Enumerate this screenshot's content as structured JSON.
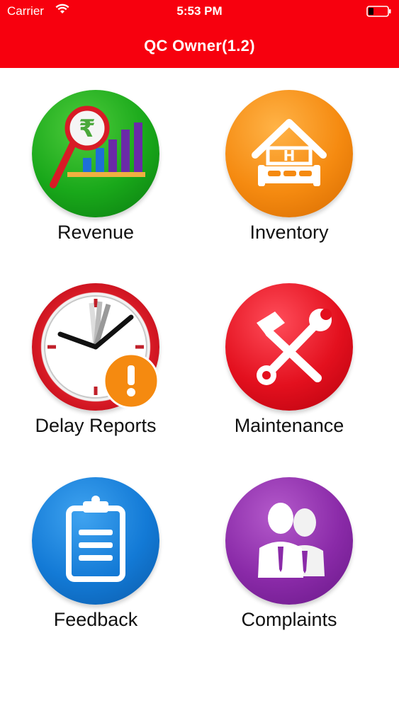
{
  "status_bar": {
    "carrier": "Carrier",
    "time": "5:53 PM"
  },
  "header": {
    "title": "QC Owner(1.2)"
  },
  "menu": {
    "items": [
      {
        "label": "Revenue",
        "icon": "revenue-chart-icon",
        "color": "#19a81a"
      },
      {
        "label": "Inventory",
        "icon": "hotel-house-icon",
        "color": "#f58a10"
      },
      {
        "label": "Delay Reports",
        "icon": "clock-alert-icon",
        "color": "#d81b26"
      },
      {
        "label": "Maintenance",
        "icon": "tools-icon",
        "color": "#e3101e"
      },
      {
        "label": "Feedback",
        "icon": "clipboard-icon",
        "color": "#137ad6"
      },
      {
        "label": "Complaints",
        "icon": "people-icon",
        "color": "#8a2aa8"
      }
    ]
  },
  "colors": {
    "header_bg": "#f7000e",
    "alert_badge": "#f58a10"
  }
}
